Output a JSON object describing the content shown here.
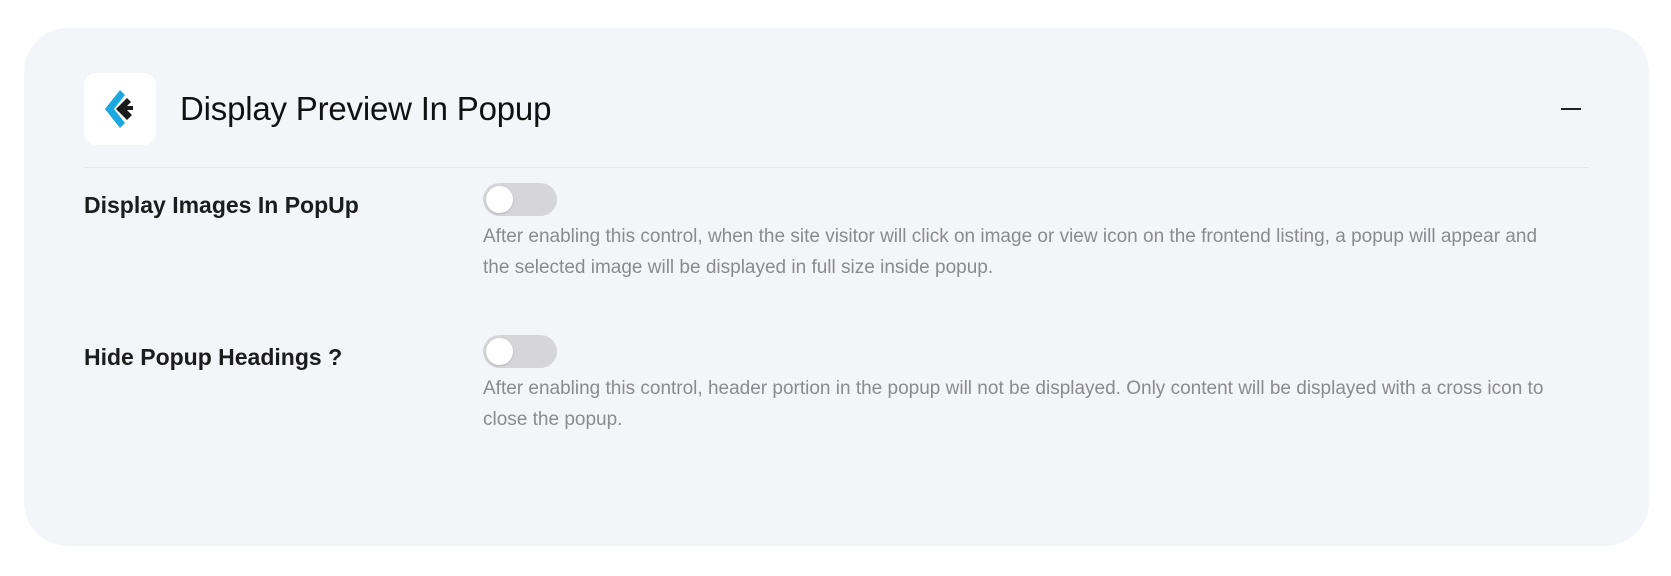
{
  "section": {
    "title": "Display Preview In Popup",
    "collapse_icon": "minus-icon",
    "logo_icon": "brand-logo-icon",
    "accent_color": "#1ba7e0"
  },
  "settings": [
    {
      "label": "Display Images In PopUp",
      "enabled": false,
      "description": "After enabling this control, when the site visitor will click on image or view icon on the frontend listing, a popup will appear and the selected image will be displayed in full size inside popup."
    },
    {
      "label": "Hide Popup Headings ?",
      "enabled": false,
      "description": "After enabling this control, header portion in the popup will not be displayed. Only content will be displayed with a cross icon to close the popup."
    }
  ]
}
